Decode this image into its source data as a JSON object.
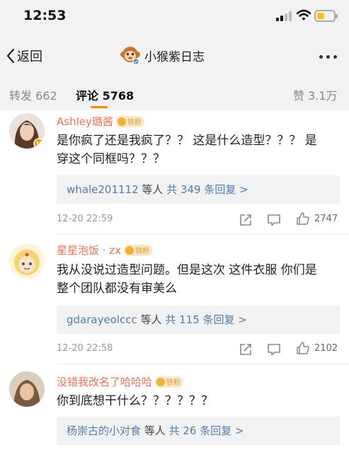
{
  "status_bar": {
    "time": "12:53"
  },
  "nav": {
    "back_label": "返回",
    "title": "小猴紫日志"
  },
  "tabs": {
    "repost_label": "转发 662",
    "comment_label": "评论 5768",
    "like_label": "赞 3.1万"
  },
  "badge_text": "铁粉",
  "reply_etc": "等人",
  "colors": {
    "accent": "#ff8200",
    "username": "#eb7350",
    "link": "#507daf"
  },
  "comments": [
    {
      "user": "Ashley璐酱",
      "text_line1": "是你疯了还是我疯了？？ 这是什么造型？？？ 是",
      "text_line2": "穿这个同框吗？？？",
      "reply_users": "whale201112",
      "reply_count": "共 349 条回复 >",
      "time": "12-20 22:59",
      "likes": "2747"
    },
    {
      "user": "星星泡饭 · zx",
      "text_line1": "我从没说过造型问题。但是这次 这件衣服 你们是",
      "text_line2": "整个团队都没有审美么",
      "reply_users": "gdarayeolccc",
      "reply_count": "共 115 条回复 >",
      "time": "12-20 22:58",
      "likes": "2102"
    },
    {
      "user": "没错我改名了哈哈哈",
      "text_line1": "你到底想干什么？？？？？？",
      "reply_users": "杨崇古的小对食",
      "reply_count": "共 26 条回复 >"
    }
  ]
}
